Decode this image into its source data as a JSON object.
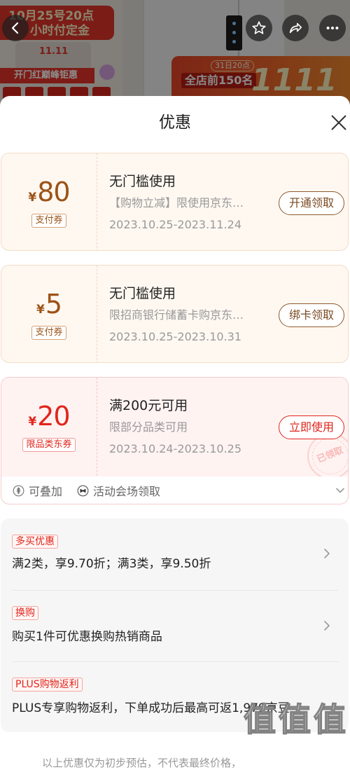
{
  "promo_background": {
    "banner_line1": "10月25号20点",
    "banner_line2": "小时付定金",
    "festival_badge": "11.11",
    "ribbon": "开门红巅峰钜惠",
    "right_time": "31日20点",
    "right_rank": "全店前150名",
    "right_big": "1111"
  },
  "top_actions": [
    {
      "icon": "back-arrow-icon"
    },
    {
      "icon": "star-icon"
    },
    {
      "icon": "share-icon"
    },
    {
      "icon": "more-icon"
    }
  ],
  "sheet": {
    "title": "优惠",
    "close_icon": "close-icon"
  },
  "coupons": [
    {
      "currency": "¥",
      "amount": "80",
      "tag": "支付券",
      "condition": "无门槛使用",
      "desc": "【购物立减】限使用京东…",
      "validity": "2023.10.25-2023.11.24",
      "action": "开通领取"
    },
    {
      "currency": "¥",
      "amount": "5",
      "tag": "支付券",
      "condition": "无门槛使用",
      "desc": "限招商银行储蓄卡购京东…",
      "validity": "2023.10.25-2023.10.31",
      "action": "绑卡领取"
    },
    {
      "currency": "¥",
      "amount": "20",
      "tag": "限品类东券",
      "condition": "满200元可用",
      "desc": "限部分品类可用",
      "validity": "2023.10.24-2023.10.25",
      "action": "立即使用",
      "stamp": "已领取",
      "footer": {
        "stackable": "可叠加",
        "stackable_icon": "stack-icon",
        "source": "活动会场领取",
        "source_icon": "venue-icon",
        "expand_icon": "chevron-down-icon"
      }
    }
  ],
  "offers": [
    {
      "tag": "多买优惠",
      "text": "满2类，享9.70折；满3类，享9.50折"
    },
    {
      "tag": "换购",
      "text": "购买1件可优惠换购热销商品"
    },
    {
      "tag": "PLUS购物返利",
      "text": "PLUS专享购物返利，下单成功后最高可返1,979京豆"
    }
  ],
  "footnote": "以上优惠仅为初步预估，不代表最终价格，",
  "watermark": "值值值",
  "theme": {
    "brown": "#9c5317",
    "red": "#e1251b",
    "brown_bg": "#fff8f1",
    "red_bg": "#fff3f2"
  }
}
